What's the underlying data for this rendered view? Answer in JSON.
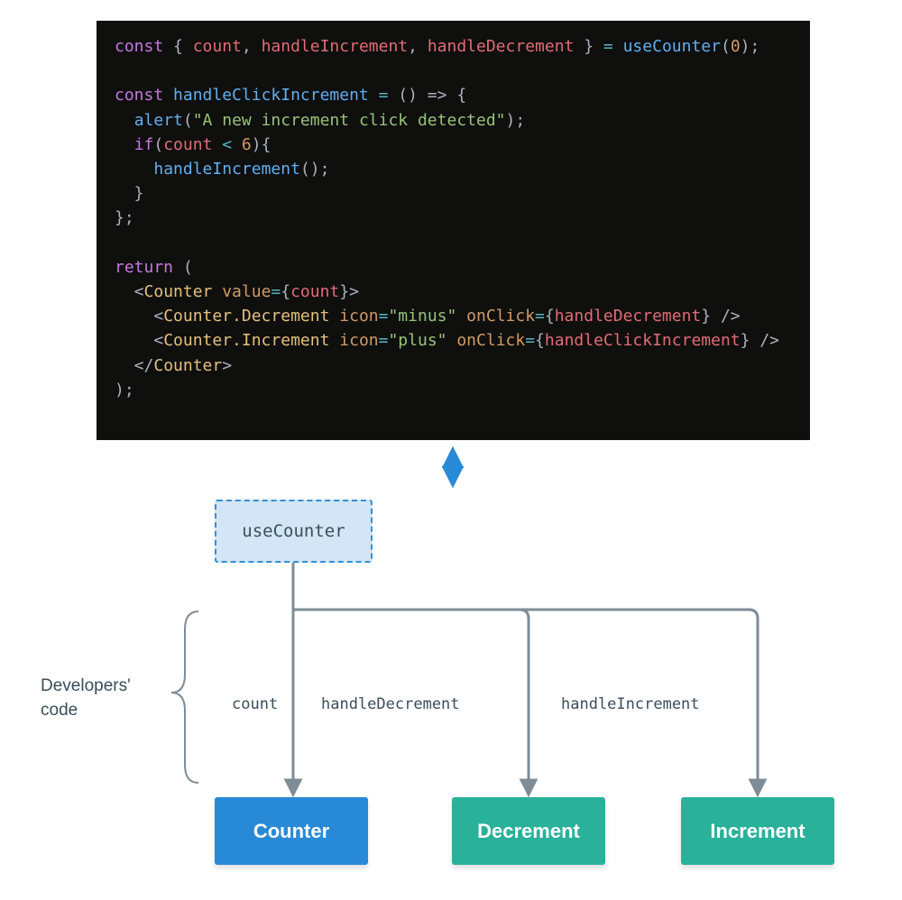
{
  "code": {
    "line1": {
      "const": "const",
      "open": " { ",
      "count": "count",
      "c1": ", ",
      "hi": "handleIncrement",
      "c2": ", ",
      "hd": "handleDecrement",
      "close": " } ",
      "eq": "= ",
      "fn": "useCounter",
      "lp": "(",
      "zero": "0",
      "rp": ");"
    },
    "line3": {
      "const": "const",
      "sp": " ",
      "name": "handleClickIncrement",
      "eq": " = ",
      "arrow": "() => {"
    },
    "line4": {
      "indent": "  ",
      "fn": "alert",
      "lp": "(",
      "str": "\"A new increment click detected\"",
      "rp": ");"
    },
    "line5": {
      "indent": "  ",
      "kw": "if",
      "lp": "(",
      "var": "count",
      "op": " < ",
      "num": "6",
      "rp": "){"
    },
    "line6": {
      "indent": "    ",
      "fn": "handleIncrement",
      "call": "();"
    },
    "line7": {
      "txt": "  }"
    },
    "line8": {
      "txt": "};"
    },
    "line10": {
      "kw": "return",
      "rest": " ("
    },
    "line11": {
      "indent": "  <",
      "comp": "Counter",
      "sp": " ",
      "attr": "value",
      "eq": "=",
      "lb": "{",
      "val": "count",
      "rb": "}>"
    },
    "line12": {
      "indent": "    <",
      "comp": "Counter.Decrement",
      "sp": " ",
      "attr1": "icon",
      "eq1": "=",
      "str1": "\"minus\"",
      "sp2": " ",
      "attr2": "onClick",
      "eq2": "=",
      "lb": "{",
      "val": "handleDecrement",
      "rb": "} />"
    },
    "line13": {
      "indent": "    <",
      "comp": "Counter.Increment",
      "sp": " ",
      "attr1": "icon",
      "eq1": "=",
      "str1": "\"plus\"",
      "sp2": " ",
      "attr2": "onClick",
      "eq2": "=",
      "lb": "{",
      "val": "handleClickIncrement",
      "rb": "} />"
    },
    "line14": {
      "indent": "  </",
      "comp": "Counter",
      "close": ">"
    },
    "line15": {
      "txt": ");"
    }
  },
  "diagram": {
    "usecounter": "useCounter",
    "counter": "Counter",
    "decrement": "Decrement",
    "increment": "Increment",
    "edge_count": "count",
    "edge_dec": "handleDecrement",
    "edge_inc": "handleIncrement",
    "dev_label_1": "Developers'",
    "dev_label_2": "code"
  }
}
